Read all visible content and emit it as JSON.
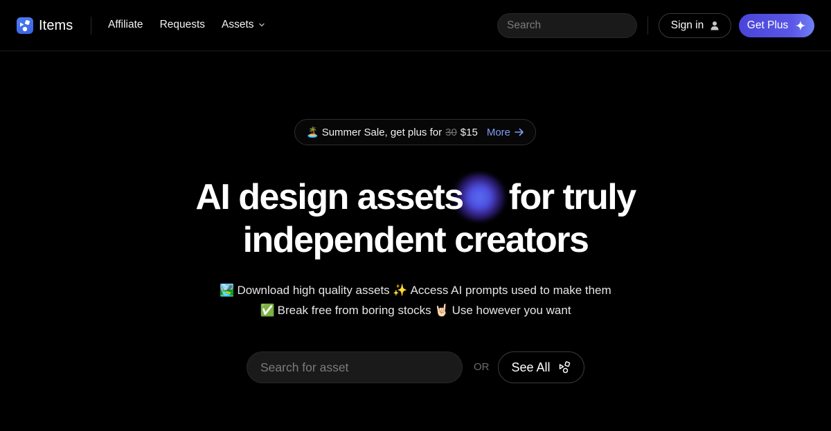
{
  "header": {
    "logo_text": "Items",
    "nav": [
      {
        "label": "Affiliate"
      },
      {
        "label": "Requests"
      },
      {
        "label": "Assets",
        "has_dropdown": true
      }
    ],
    "search": {
      "placeholder": "Search",
      "value": ""
    },
    "signin_label": "Sign in",
    "getplus_label": "Get Plus"
  },
  "promo": {
    "emoji": "🏝️",
    "text": "Summer Sale, get plus for",
    "old_price": "30",
    "new_price": "$15",
    "more_label": "More"
  },
  "hero": {
    "title_line1_a": "AI design assets",
    "title_line1_b": "for truly",
    "title_line2": "independent creators"
  },
  "features": {
    "line1": [
      {
        "emoji": "🏞️",
        "text": "Download high quality assets"
      },
      {
        "emoji": "✨",
        "text": "Access AI prompts used to make them"
      }
    ],
    "line2": [
      {
        "emoji": "✅",
        "text": "Break free from boring stocks"
      },
      {
        "emoji": "🤘🏻",
        "text": "Use however you want"
      }
    ]
  },
  "cta": {
    "search_placeholder": "Search for asset",
    "search_value": "",
    "or_label": "OR",
    "seeall_label": "See All"
  },
  "colors": {
    "accent": "#5a56e6",
    "link": "#7f9cf5",
    "logo": "#4f7df5",
    "background": "#000000"
  }
}
